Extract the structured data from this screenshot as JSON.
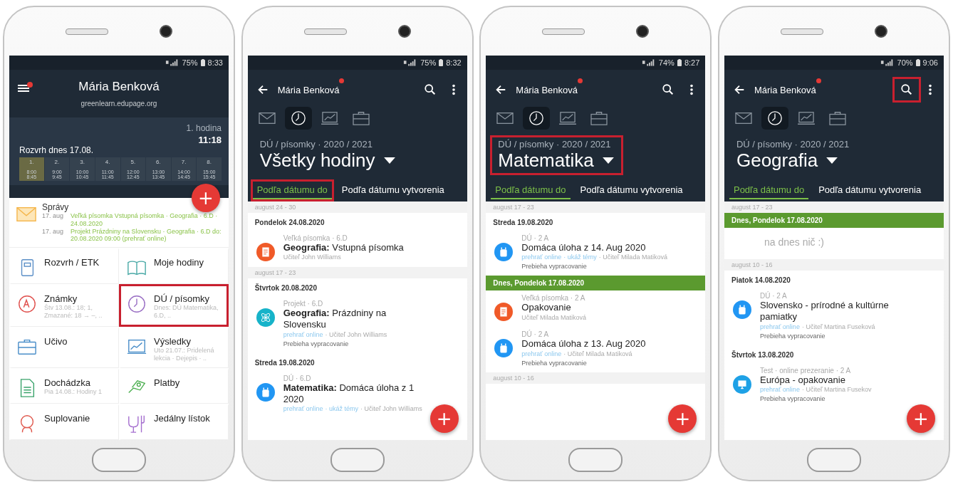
{
  "phones": [
    {
      "kind": "dashboard",
      "status": {
        "battery": "75%",
        "time": "8:33"
      },
      "header": {
        "name": "Mária Benková",
        "domain": "greenlearn.edupage.org",
        "unread": true
      },
      "lesson": {
        "label": "1. hodina",
        "time": "11:18"
      },
      "timetable": {
        "title": "Rozvrh dnes 17.08.",
        "periods": [
          {
            "number": "1.",
            "start": "8:00",
            "end": "8:45",
            "selected": true
          },
          {
            "number": "2.",
            "start": "9:00",
            "end": "9:45",
            "selected": false
          },
          {
            "number": "3.",
            "start": "10:00",
            "end": "10:45",
            "selected": false
          },
          {
            "number": "4.",
            "start": "11:00",
            "end": "11:45",
            "selected": false
          },
          {
            "number": "5.",
            "start": "12:00",
            "end": "12:45",
            "selected": false
          },
          {
            "number": "6.",
            "start": "13:00",
            "end": "13:45",
            "selected": false
          },
          {
            "number": "7.",
            "start": "14:00",
            "end": "14:45",
            "selected": false
          },
          {
            "number": "8.",
            "start": "15:00",
            "end": "15:45",
            "selected": false
          }
        ]
      },
      "fab": {
        "label": "+"
      },
      "messages": {
        "title": "Správy",
        "items": [
          {
            "date": "17. aug",
            "text": "Veľká písomka Vstupná písomka · Geografia · 6.D · 24.08.2020"
          },
          {
            "date": "17. aug",
            "text": "Projekt Prázdniny na Slovensku · Geografia · 6.D do: 20.08.2020 09:00 (prehrať online)"
          }
        ]
      },
      "tiles": [
        {
          "label": "Rozvrh / ETK",
          "highlighted": false
        },
        {
          "label": "Moje hodiny",
          "highlighted": false
        },
        {
          "label": "Známky",
          "detail": "Štv 13.08.: 18; 1, Zmazané: 18 → –, ..",
          "highlighted": false
        },
        {
          "label": "DÚ / písomky",
          "detail": "Dnes: DÚ Matematika, 6.D, ..",
          "highlighted": true
        },
        {
          "label": "Učivo",
          "highlighted": false
        },
        {
          "label": "Výsledky",
          "detail": "Uto 21.07.: Pridelená lekcia · Dejepis · ..",
          "highlighted": false
        },
        {
          "label": "Dochádzka",
          "detail": "Pia 14.08.: Hodiny 1",
          "highlighted": false
        },
        {
          "label": "Platby",
          "highlighted": false
        },
        {
          "label": "Suplovanie",
          "highlighted": false
        },
        {
          "label": "Jedálny lístok",
          "highlighted": false
        }
      ]
    },
    {
      "kind": "list",
      "status": {
        "battery": "75%",
        "time": "8:32"
      },
      "toolbar": {
        "name": "Mária Benková",
        "unread": true,
        "search_highlighted": false
      },
      "nav": [
        {
          "selected": false
        },
        {
          "selected": true
        },
        {
          "selected": false
        },
        {
          "selected": false
        }
      ],
      "heading": {
        "subtitle": "DÚ / písomky · 2020 / 2021",
        "title": "Všetky hodiny",
        "highlighted": false
      },
      "tabs": [
        {
          "label": "Podľa dátumu do",
          "selected": true,
          "highlighted": true
        },
        {
          "label": "Podľa dátumu vytvorenia",
          "selected": false,
          "highlighted": false
        }
      ],
      "fab": {
        "label": "+"
      },
      "rows": [
        {
          "kind": "week",
          "text": "august 24 - 30"
        },
        {
          "kind": "day",
          "text": "Pondelok 24.08.2020"
        },
        {
          "kind": "exam",
          "meta": "Veľká písomka · 6.D",
          "title": "**Geografia:** Vstupná písomka",
          "byline": [
            {
              "kind": "plain",
              "text": "Učiteľ John Williams"
            }
          ]
        },
        {
          "kind": "week",
          "text": "august 17 - 23"
        },
        {
          "kind": "day",
          "text": "Štvrtok 20.08.2020"
        },
        {
          "kind": "project",
          "meta": "Projekt · 6.D",
          "title": "**Geografia:** Prázdniny na Slovensku",
          "byline": [
            {
              "kind": "link",
              "text": "prehrať online"
            },
            {
              "kind": "plain",
              "text": "· Učiteľ John Williams"
            }
          ],
          "status": "Prebieha vypracovanie"
        },
        {
          "kind": "day",
          "text": "Streda 19.08.2020"
        },
        {
          "kind": "homework",
          "meta": "DÚ · 6.D",
          "title": "**Matematika:** Domáca úloha z 1\n2020",
          "byline": [
            {
              "kind": "link",
              "text": "prehrať online"
            },
            {
              "kind": "link",
              "text": "· ukáž témy"
            },
            {
              "kind": "plain",
              "text": "· Učiteľ John Williams"
            }
          ]
        }
      ]
    },
    {
      "kind": "list",
      "status": {
        "battery": "74%",
        "time": "8:27"
      },
      "toolbar": {
        "name": "Mária Benková",
        "unread": true,
        "search_highlighted": false
      },
      "nav": [
        {
          "selected": false
        },
        {
          "selected": true
        },
        {
          "selected": false
        },
        {
          "selected": false
        }
      ],
      "heading": {
        "subtitle": "DÚ / písomky · 2020 / 2021",
        "title": "Matematika",
        "highlighted": true
      },
      "tabs": [
        {
          "label": "Podľa dátumu do",
          "selected": true,
          "highlighted": false
        },
        {
          "label": "Podľa dátumu vytvorenia",
          "selected": false,
          "highlighted": false
        }
      ],
      "fab": {
        "label": "+"
      },
      "rows": [
        {
          "kind": "week",
          "text": "august 17 - 23"
        },
        {
          "kind": "day",
          "text": "Streda 19.08.2020"
        },
        {
          "kind": "homework",
          "meta": "DÚ · 2 A",
          "title": "Domáca úloha z 14. Aug 2020",
          "byline": [
            {
              "kind": "link",
              "text": "prehrať online"
            },
            {
              "kind": "link",
              "text": "· ukáž témy"
            },
            {
              "kind": "plain",
              "text": "· Učiteľ Milada Matiková"
            }
          ],
          "status": "Prebieha vypracovanie"
        },
        {
          "kind": "today",
          "text": "Dnes, Pondelok 17.08.2020"
        },
        {
          "kind": "exam",
          "meta": "Veľká písomka · 2 A",
          "title": "Opakovanie",
          "byline": [
            {
              "kind": "plain",
              "text": "Učiteľ Milada Matiková"
            }
          ]
        },
        {
          "kind": "homework",
          "meta": "DÚ · 2 A",
          "title": "Domáca úloha z 13. Aug 2020",
          "byline": [
            {
              "kind": "link",
              "text": "prehrať online"
            },
            {
              "kind": "plain",
              "text": "· Učiteľ Milada Matiková"
            }
          ],
          "status": "Prebieha vypracovanie"
        },
        {
          "kind": "week",
          "text": "august 10 - 16"
        }
      ]
    },
    {
      "kind": "list",
      "status": {
        "battery": "70%",
        "time": "9:06"
      },
      "toolbar": {
        "name": "Mária Benková",
        "unread": true,
        "search_highlighted": true
      },
      "nav": [
        {
          "selected": false
        },
        {
          "selected": true
        },
        {
          "selected": false
        },
        {
          "selected": false
        }
      ],
      "heading": {
        "subtitle": "DÚ / písomky · 2020 / 2021",
        "title": "Geografia",
        "highlighted": false
      },
      "tabs": [
        {
          "label": "Podľa dátumu do",
          "selected": true,
          "highlighted": false
        },
        {
          "label": "Podľa dátumu vytvorenia",
          "selected": false,
          "highlighted": false
        }
      ],
      "fab": {
        "label": "+"
      },
      "rows": [
        {
          "kind": "week",
          "text": "august 17 - 23"
        },
        {
          "kind": "today",
          "text": "Dnes, Pondelok 17.08.2020"
        },
        {
          "kind": "empty",
          "text": "na dnes nič :)"
        },
        {
          "kind": "week",
          "text": "august 10 - 16"
        },
        {
          "kind": "day",
          "text": "Piatok 14.08.2020"
        },
        {
          "kind": "homework",
          "meta": "DÚ · 2 A",
          "title": "Slovensko - prírodné a kultúrne pamiatky",
          "byline": [
            {
              "kind": "link",
              "text": "prehrať online"
            },
            {
              "kind": "plain",
              "text": "· Učiteľ Martina Fuseková"
            }
          ],
          "status": "Prebieha vypracovanie"
        },
        {
          "kind": "day",
          "text": "Štvrtok 13.08.2020"
        },
        {
          "kind": "test",
          "meta": "Test · online prezeranie · 2 A",
          "title": "Európa - opakovanie",
          "byline": [
            {
              "kind": "link",
              "text": "prehrať online"
            },
            {
              "kind": "plain",
              "text": "· Učiteľ Martina Fusekov"
            }
          ],
          "status": "Prebieha vypracovanie"
        }
      ]
    }
  ]
}
